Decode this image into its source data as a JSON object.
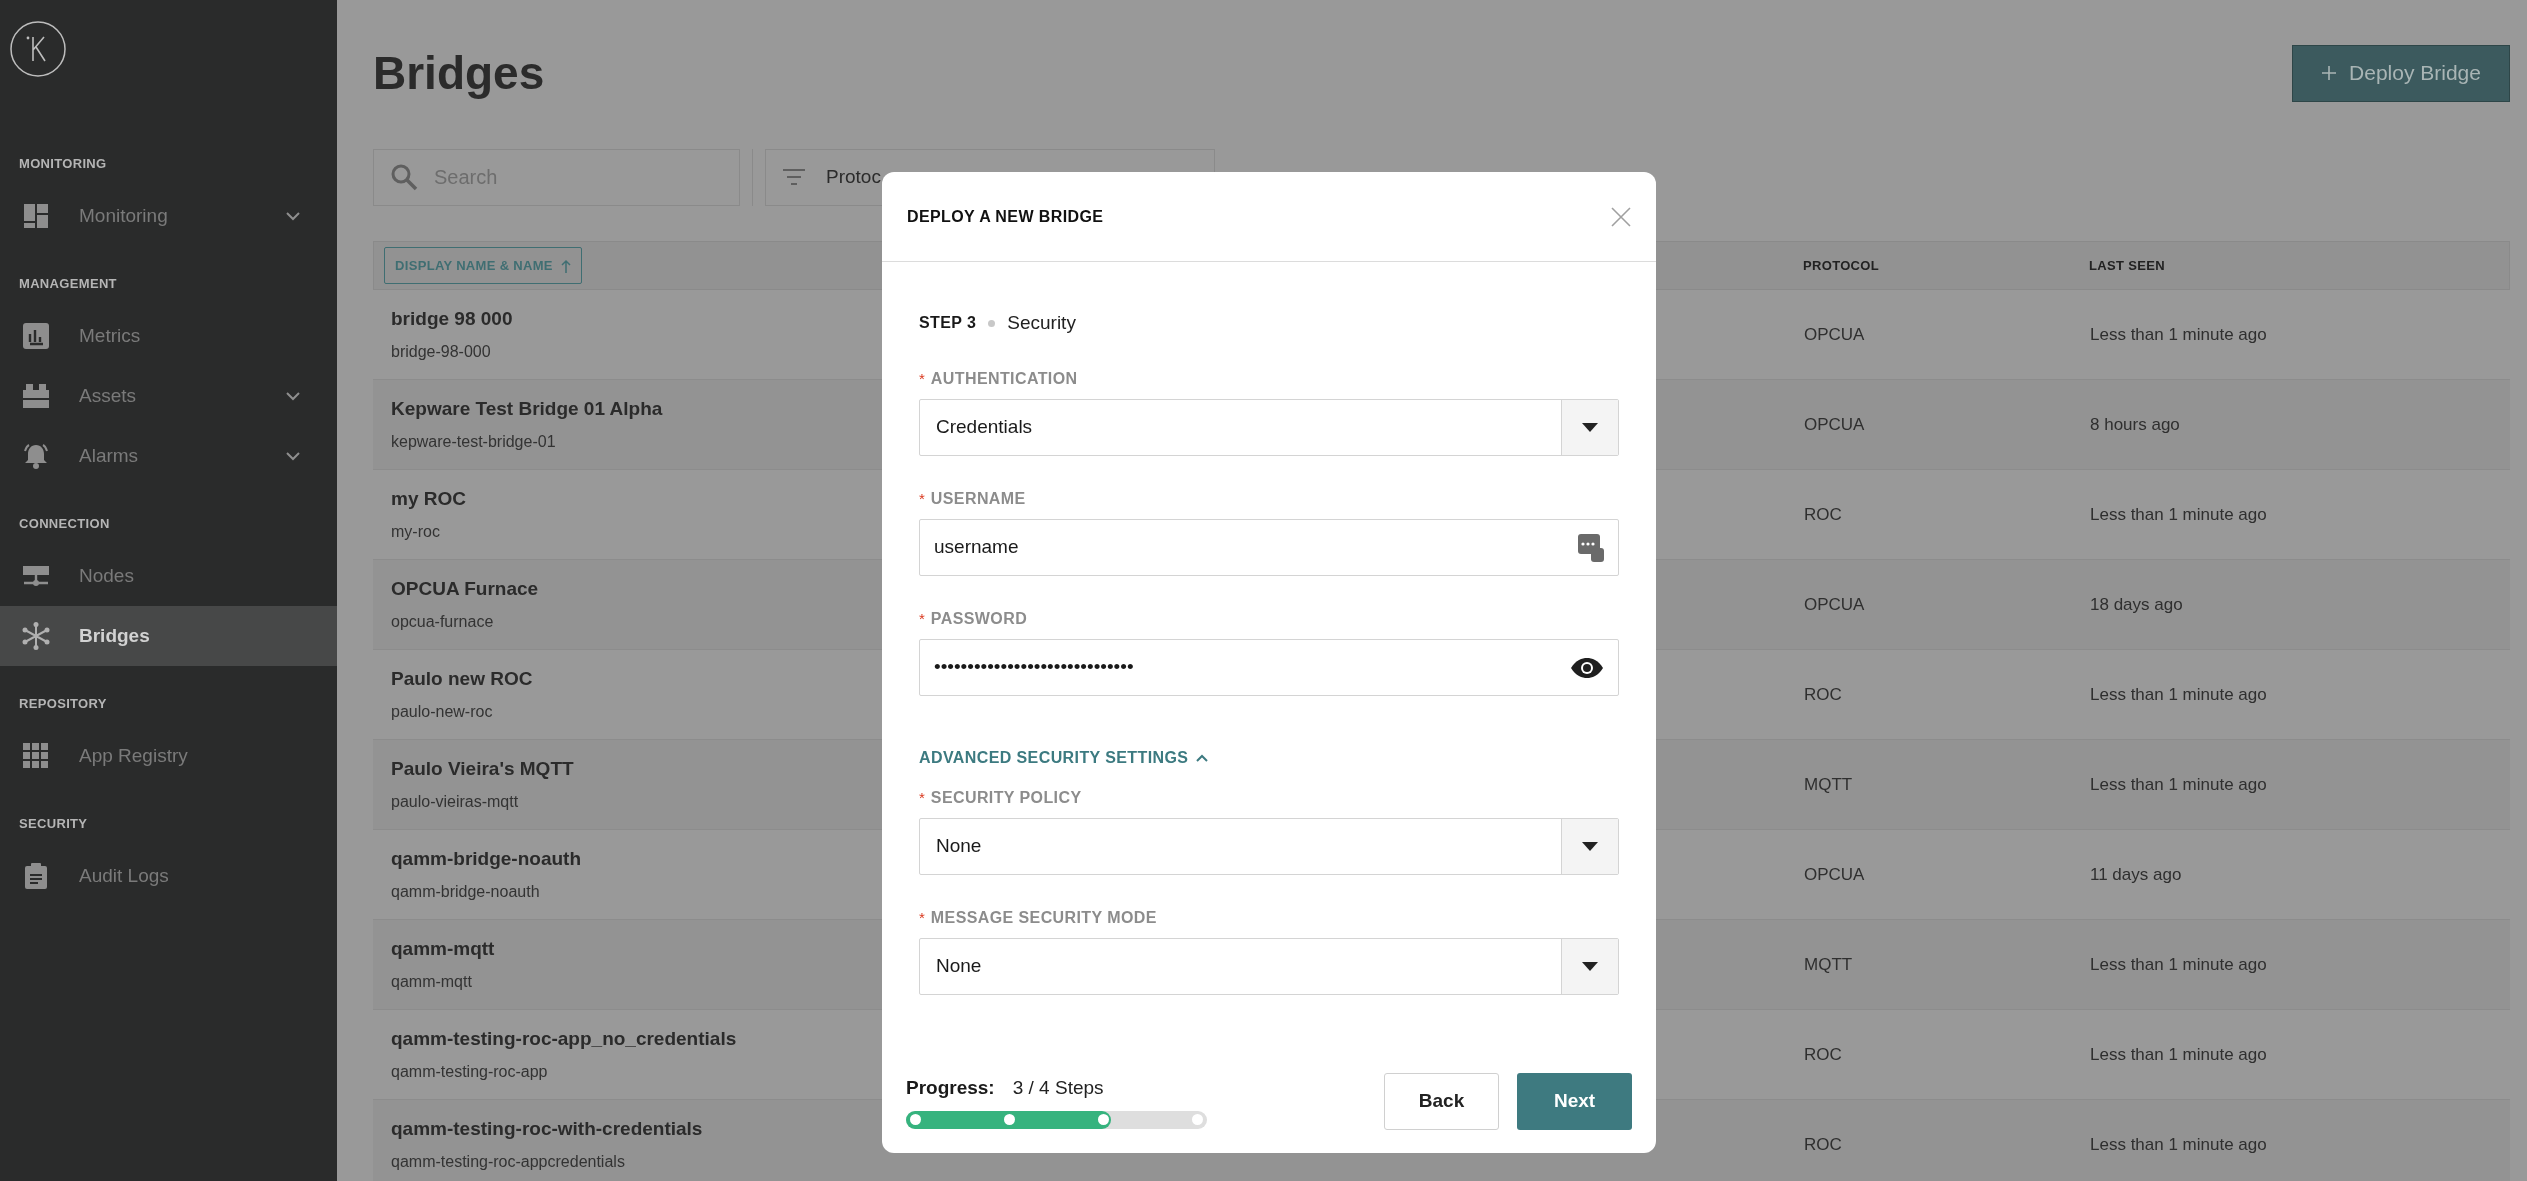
{
  "sidebar": {
    "sections": [
      {
        "title": "MONITORING",
        "items": [
          {
            "label": "Monitoring",
            "expandable": true,
            "selected": false
          }
        ]
      },
      {
        "title": "MANAGEMENT",
        "items": [
          {
            "label": "Metrics",
            "expandable": false,
            "selected": false
          },
          {
            "label": "Assets",
            "expandable": true,
            "selected": false
          },
          {
            "label": "Alarms",
            "expandable": true,
            "selected": false
          }
        ]
      },
      {
        "title": "CONNECTION",
        "items": [
          {
            "label": "Nodes",
            "expandable": false,
            "selected": false
          },
          {
            "label": "Bridges",
            "expandable": false,
            "selected": true
          }
        ]
      },
      {
        "title": "REPOSITORY",
        "items": [
          {
            "label": "App Registry",
            "expandable": false,
            "selected": false
          }
        ]
      },
      {
        "title": "SECURITY",
        "items": [
          {
            "label": "Audit Logs",
            "expandable": false,
            "selected": false
          }
        ]
      }
    ]
  },
  "page": {
    "title": "Bridges",
    "deploy_button": "Deploy Bridge",
    "search": {
      "placeholder": "Search"
    },
    "protocol_filter": {
      "value": "Protoc"
    }
  },
  "table": {
    "sort_chip": "DISPLAY NAME & NAME",
    "columns": [
      "PROTOCOL",
      "LAST SEEN"
    ],
    "rows": [
      {
        "display_name": "bridge 98 000",
        "name": "bridge-98-000",
        "protocol": "OPCUA",
        "last_seen": "Less than 1 minute ago"
      },
      {
        "display_name": "Kepware Test Bridge 01 Alpha",
        "name": "kepware-test-bridge-01",
        "protocol": "OPCUA",
        "last_seen": "8 hours ago"
      },
      {
        "display_name": "my ROC",
        "name": "my-roc",
        "protocol": "ROC",
        "last_seen": "Less than 1 minute ago"
      },
      {
        "display_name": "OPCUA Furnace",
        "name": "opcua-furnace",
        "protocol": "OPCUA",
        "last_seen": "18 days ago"
      },
      {
        "display_name": "Paulo new ROC",
        "name": "paulo-new-roc",
        "protocol": "ROC",
        "last_seen": "Less than 1 minute ago"
      },
      {
        "display_name": "Paulo Vieira's MQTT",
        "name": "paulo-vieiras-mqtt",
        "protocol": "MQTT",
        "last_seen": "Less than 1 minute ago"
      },
      {
        "display_name": "qamm-bridge-noauth",
        "name": "qamm-bridge-noauth",
        "protocol": "OPCUA",
        "last_seen": "11 days ago"
      },
      {
        "display_name": "qamm-mqtt",
        "name": "qamm-mqtt",
        "protocol": "MQTT",
        "last_seen": "Less than 1 minute ago"
      },
      {
        "display_name": "qamm-testing-roc-app_no_credentials",
        "name": "qamm-testing-roc-app",
        "protocol": "ROC",
        "last_seen": "Less than 1 minute ago"
      },
      {
        "display_name": "qamm-testing-roc-with-credentials",
        "name": "qamm-testing-roc-appcredentials",
        "protocol": "ROC",
        "last_seen": "Less than 1 minute ago"
      }
    ]
  },
  "modal": {
    "title": "DEPLOY A NEW BRIDGE",
    "step": "STEP 3",
    "step_name": "Security",
    "fields": [
      {
        "kind": "select",
        "required_mark": "*",
        "label": "AUTHENTICATION",
        "value": "Credentials"
      },
      {
        "kind": "text",
        "required_mark": "*",
        "label": "USERNAME",
        "value": "username"
      },
      {
        "kind": "password",
        "required_mark": "*",
        "label": "PASSWORD",
        "value": "••••••••••••••••••••••••••••••"
      }
    ],
    "advanced_link": "ADVANCED SECURITY SETTINGS",
    "advanced_expanded": true,
    "advanced_fields": [
      {
        "kind": "select",
        "required_mark": "*",
        "label": "SECURITY POLICY",
        "value": "None"
      },
      {
        "kind": "select",
        "required_mark": "*",
        "label": "MESSAGE SECURITY MODE",
        "value": "None"
      }
    ],
    "progress": {
      "label": "Progress:",
      "text": "3 / 4 Steps",
      "level": 0.68
    },
    "buttons": {
      "back": "Back",
      "next": "Next"
    }
  }
}
